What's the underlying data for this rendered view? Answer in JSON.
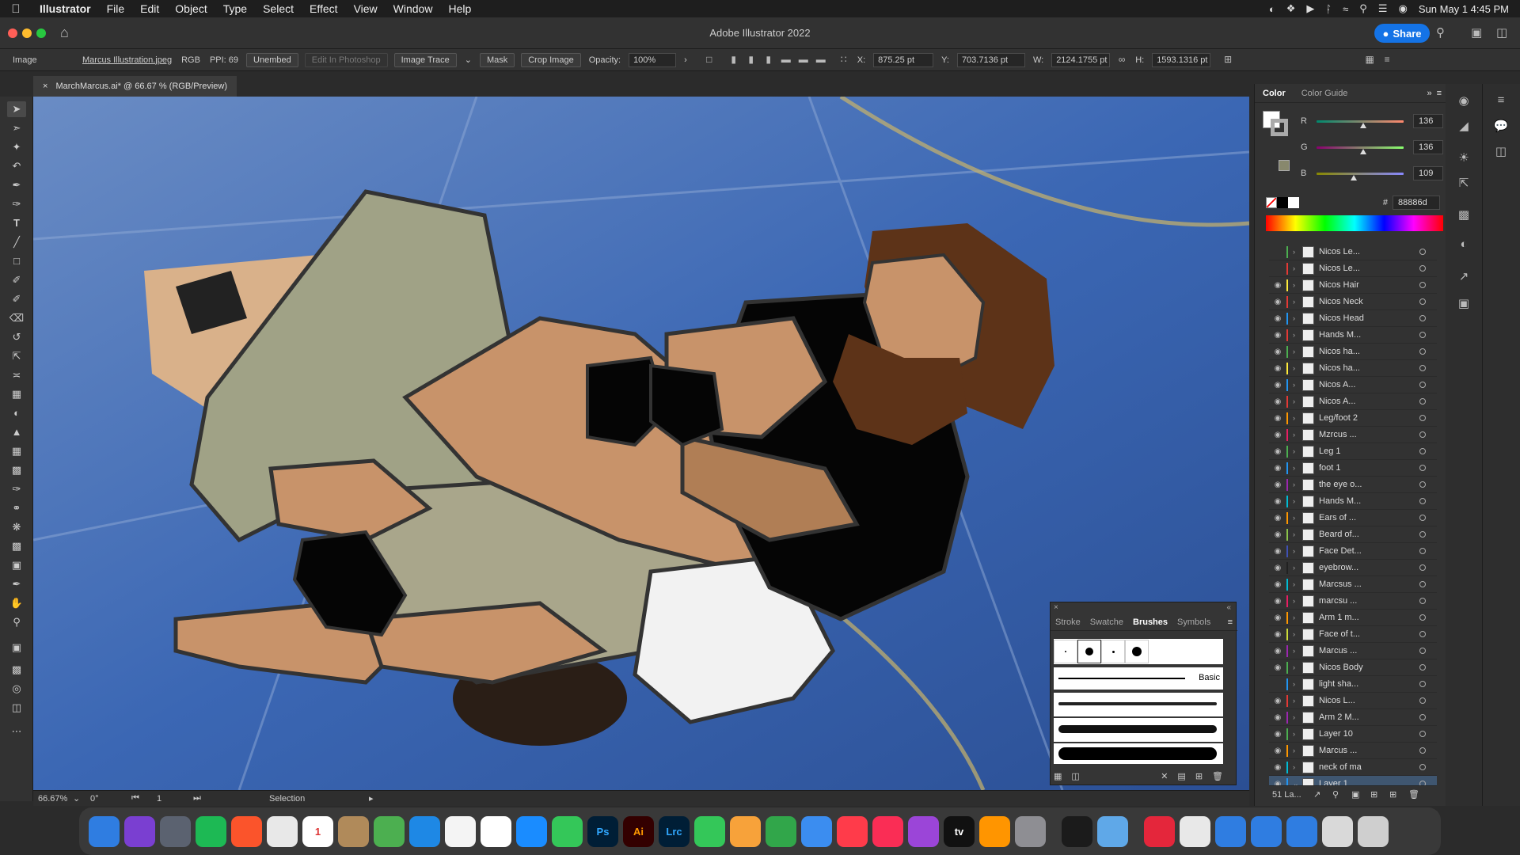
{
  "menubar": {
    "apple_icon": "apple-icon",
    "app_name": "Illustrator",
    "items": [
      "File",
      "Edit",
      "Object",
      "Type",
      "Select",
      "Effect",
      "View",
      "Window",
      "Help"
    ],
    "clock": "Sun May 1  4:45 PM",
    "status_icons": [
      "creative-cloud-icon",
      "dropbox-icon",
      "play-icon",
      "bluetooth-icon",
      "wifi-icon",
      "search-icon",
      "control-center-icon",
      "siri-icon"
    ]
  },
  "titlebar": {
    "title": "Adobe Illustrator 2022",
    "share_label": "Share"
  },
  "control_bar": {
    "selection_type": "Image",
    "file_name": "Marcus Illustration.jpeg",
    "color_mode": "RGB",
    "ppi": "PPI: 69",
    "unembed": "Unembed",
    "edit_photoshop": "Edit In Photoshop",
    "image_trace": "Image Trace",
    "mask": "Mask",
    "crop_image": "Crop Image",
    "opacity_label": "Opacity:",
    "opacity_value": "100%",
    "x_label": "X:",
    "x_value": "875.25 pt",
    "y_label": "Y:",
    "y_value": "703.7136 pt",
    "w_label": "W:",
    "w_value": "2124.1755 pt",
    "h_label": "H:",
    "h_value": "1593.1316 pt"
  },
  "document_tab": {
    "close": "×",
    "title": "MarchMarcus.ai* @ 66.67 % (RGB/Preview)"
  },
  "status_bar": {
    "zoom": "66.67%",
    "rotation": "0°",
    "artboard": "1",
    "tool": "Selection"
  },
  "color_panel": {
    "tabs": [
      "Color",
      "Color Guide"
    ],
    "r_label": "R",
    "r": 136,
    "g_label": "G",
    "g": 136,
    "b_label": "B",
    "b": 109,
    "hex_prefix": "#",
    "hex": "88886d",
    "swatch_color": "#88886d"
  },
  "layers": [
    {
      "name": "Nicos Le...",
      "visible": false,
      "color": "#4caf50"
    },
    {
      "name": "Nicos Le...",
      "visible": false,
      "color": "#e53935"
    },
    {
      "name": "Nicos Hair",
      "visible": true,
      "color": "#ffeb3b"
    },
    {
      "name": "Nicos Neck",
      "visible": true,
      "color": "#e53935"
    },
    {
      "name": "Nicos Head",
      "visible": true,
      "color": "#2196f3"
    },
    {
      "name": "Hands M...",
      "visible": true,
      "color": "#e53935"
    },
    {
      "name": "Nicos ha...",
      "visible": true,
      "color": "#4caf50"
    },
    {
      "name": "Nicos ha...",
      "visible": true,
      "color": "#ffeb3b"
    },
    {
      "name": "Nicos A...",
      "visible": true,
      "color": "#2196f3"
    },
    {
      "name": "Nicos A...",
      "visible": true,
      "color": "#e53935"
    },
    {
      "name": "Leg/foot 2",
      "visible": true,
      "color": "#ff9800"
    },
    {
      "name": "Mzrcus ...",
      "visible": true,
      "color": "#e91e63"
    },
    {
      "name": "Leg 1",
      "visible": true,
      "color": "#4caf50"
    },
    {
      "name": "foot 1",
      "visible": true,
      "color": "#2196f3"
    },
    {
      "name": "the eye o...",
      "visible": true,
      "color": "#9c27b0"
    },
    {
      "name": "Hands M...",
      "visible": true,
      "color": "#00bcd4"
    },
    {
      "name": "Ears of ...",
      "visible": true,
      "color": "#ff9800"
    },
    {
      "name": "Beard of...",
      "visible": true,
      "color": "#8bc34a"
    },
    {
      "name": "Face Det...",
      "visible": true,
      "color": "#3f51b5"
    },
    {
      "name": "eyebrow...",
      "visible": true,
      "color": "#212121"
    },
    {
      "name": "Marcsus ...",
      "visible": true,
      "color": "#00bcd4"
    },
    {
      "name": "marcsu ...",
      "visible": true,
      "color": "#e91e63"
    },
    {
      "name": "Arm 1 m...",
      "visible": true,
      "color": "#ff9800"
    },
    {
      "name": "Face of t...",
      "visible": true,
      "color": "#cddc39"
    },
    {
      "name": "Marcus ...",
      "visible": true,
      "color": "#9c27b0"
    },
    {
      "name": "Nicos Body",
      "visible": true,
      "color": "#4caf50"
    },
    {
      "name": "light sha...",
      "visible": false,
      "color": "#2196f3"
    },
    {
      "name": "Nicos L...",
      "visible": true,
      "color": "#e53935"
    },
    {
      "name": "Arm 2 M...",
      "visible": true,
      "color": "#9c27b0"
    },
    {
      "name": "Layer 10",
      "visible": true,
      "color": "#4caf50"
    },
    {
      "name": "Marcus ...",
      "visible": true,
      "color": "#ff9800"
    },
    {
      "name": "neck of ma",
      "visible": true,
      "color": "#00bcd4"
    },
    {
      "name": "Layer 1",
      "visible": true,
      "color": "#2196f3",
      "selected": true
    }
  ],
  "layers_footer": {
    "count": "51 La..."
  },
  "brushes_panel": {
    "tabs": [
      "Stroke",
      "Swatche",
      "Brushes",
      "Symbols"
    ],
    "active_tab": "Brushes",
    "basic_label": "Basic"
  },
  "dock": {
    "apps": [
      {
        "name": "finder-icon",
        "label": "",
        "color": "#2f7de1"
      },
      {
        "name": "siri-icon",
        "label": "",
        "color": "#7a3fd1"
      },
      {
        "name": "launchpad-icon",
        "label": "",
        "color": "#5b6270"
      },
      {
        "name": "spotify-icon",
        "label": "",
        "color": "#1db954"
      },
      {
        "name": "brave-icon",
        "label": "",
        "color": "#fb542b"
      },
      {
        "name": "chrome-icon",
        "label": "",
        "color": "#e8e8e8"
      },
      {
        "name": "calendar-icon",
        "label": "1",
        "color": "#ffffff"
      },
      {
        "name": "contacts-icon",
        "label": "",
        "color": "#b08a5a"
      },
      {
        "name": "maps-icon",
        "label": "",
        "color": "#4caf50"
      },
      {
        "name": "safari-icon",
        "label": "",
        "color": "#1e88e5"
      },
      {
        "name": "photos-icon",
        "label": "",
        "color": "#f4f4f4"
      },
      {
        "name": "reminders-icon",
        "label": "",
        "color": "#ffffff"
      },
      {
        "name": "app-store-icon",
        "label": "",
        "color": "#1a8cff"
      },
      {
        "name": "messages-icon",
        "label": "",
        "color": "#34c759"
      },
      {
        "name": "photoshop-icon",
        "label": "Ps",
        "color": "#001e36"
      },
      {
        "name": "illustrator-icon",
        "label": "Ai",
        "color": "#330000"
      },
      {
        "name": "lightroom-icon",
        "label": "Lrc",
        "color": "#001e36"
      },
      {
        "name": "facetime-icon",
        "label": "",
        "color": "#34c759"
      },
      {
        "name": "pages-icon",
        "label": "",
        "color": "#f7a23a"
      },
      {
        "name": "numbers-icon",
        "label": "",
        "color": "#31a64a"
      },
      {
        "name": "keynote-icon",
        "label": "",
        "color": "#3b8df0"
      },
      {
        "name": "news-icon",
        "label": "",
        "color": "#ff3b4a"
      },
      {
        "name": "music-icon",
        "label": "",
        "color": "#fa2d55"
      },
      {
        "name": "podcasts-icon",
        "label": "",
        "color": "#9b45d8"
      },
      {
        "name": "tv-icon",
        "label": "tv",
        "color": "#111111"
      },
      {
        "name": "books-icon",
        "label": "",
        "color": "#ff9500"
      },
      {
        "name": "system-preferences-icon",
        "label": "",
        "color": "#8e8e93"
      },
      {
        "name": "activity-monitor-icon",
        "label": "",
        "color": "#1b1b1b"
      },
      {
        "name": "preview-icon",
        "label": "",
        "color": "#5fa8e8"
      },
      {
        "name": "creative-cloud-icon",
        "label": "",
        "color": "#e4263b"
      },
      {
        "name": "document-icon",
        "label": "",
        "color": "#e8e8e8"
      },
      {
        "name": "finder-window-icon",
        "label": "",
        "color": "#2f7de1"
      },
      {
        "name": "finder-window-icon-2",
        "label": "",
        "color": "#2f7de1"
      },
      {
        "name": "finder-window-icon-3",
        "label": "",
        "color": "#2f7de1"
      },
      {
        "name": "downloads-icon",
        "label": "",
        "color": "#d9d9d9"
      },
      {
        "name": "trash-icon",
        "label": "",
        "color": "#cfcfcf"
      }
    ]
  }
}
